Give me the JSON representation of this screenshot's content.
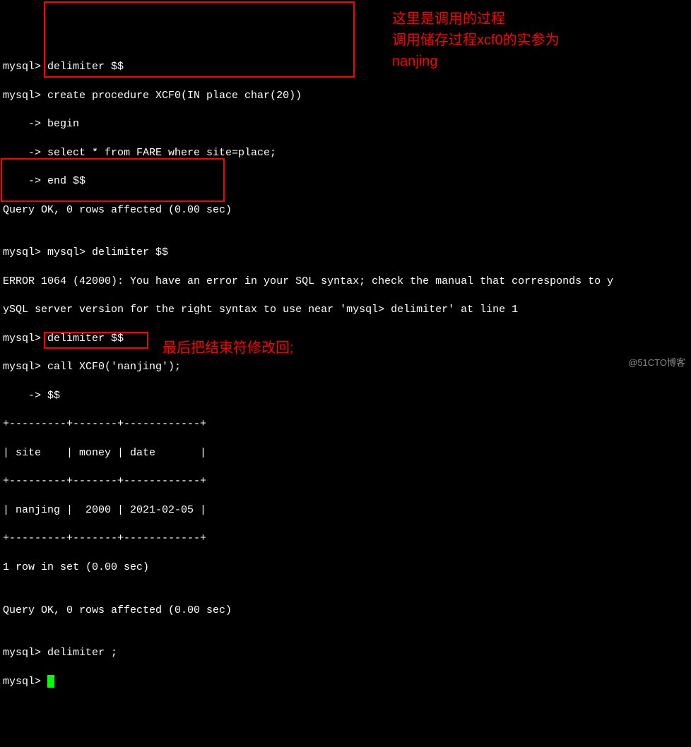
{
  "terminal": {
    "l1": "mysql> delimiter $$",
    "l2": "mysql> create procedure XCF0(IN place char(20))",
    "l3": "    -> begin",
    "l4": "    -> select * from FARE where site=place;",
    "l5": "    -> end $$",
    "l6": "Query OK, 0 rows affected (0.00 sec)",
    "l7": "",
    "l8": "mysql> mysql> delimiter $$",
    "l9": "ERROR 1064 (42000): You have an error in your SQL syntax; check the manual that corresponds to y",
    "l10": "ySQL server version for the right syntax to use near 'mysql> delimiter' at line 1",
    "l11": "mysql> delimiter $$",
    "l12": "mysql> call XCF0('nanjing');",
    "l13": "    -> $$",
    "l14": "+---------+-------+------------+",
    "l15": "| site    | money | date       |",
    "l16": "+---------+-------+------------+",
    "l17": "| nanjing |  2000 | 2021-02-05 |",
    "l18": "+---------+-------+------------+",
    "l19": "1 row in set (0.00 sec)",
    "l20": "",
    "l21": "Query OK, 0 rows affected (0.00 sec)",
    "l22": "",
    "l23": "mysql> delimiter ;",
    "l24": "mysql> "
  },
  "annotations": {
    "a1_line1": "这里是调用的过程",
    "a1_line2": "调用储存过程xcf0的实参为",
    "a1_line3": "nanjing",
    "a2": "最后把结束符修改回;"
  },
  "watermark": "@51CTO博客"
}
